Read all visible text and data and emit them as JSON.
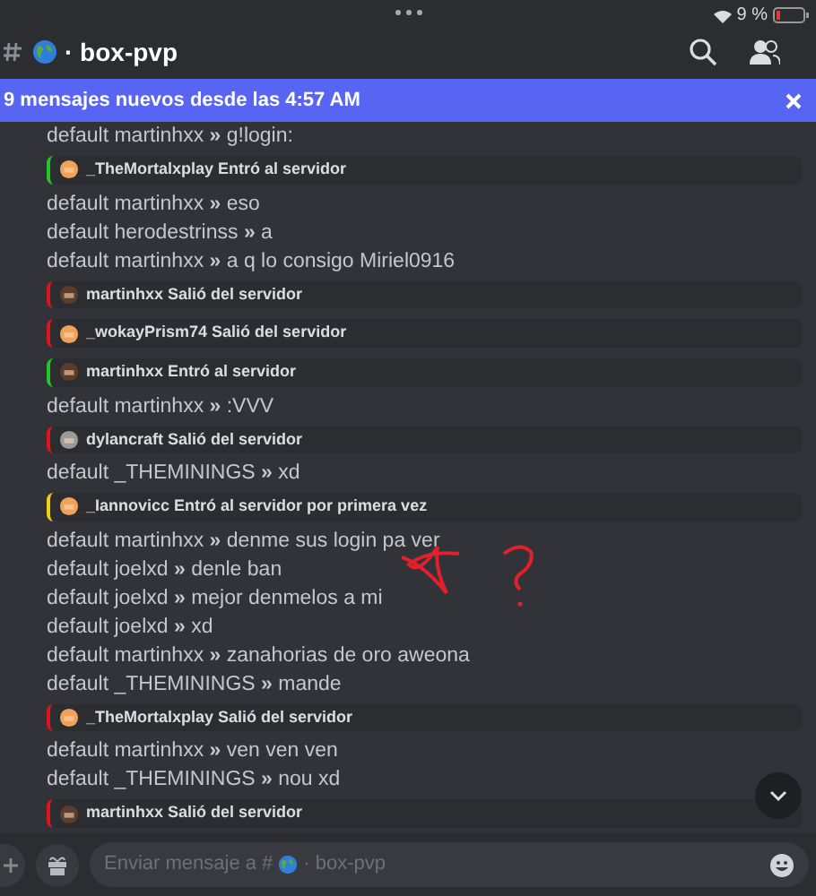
{
  "status_bar": {
    "battery_text": "9 %"
  },
  "header": {
    "channel": "· box-pvp"
  },
  "banner": {
    "text": "9 mensajes nuevos desde las 4:57 AM"
  },
  "messages": [
    {
      "kind": "chat",
      "text": "default martinhxx **»** g!login:"
    },
    {
      "kind": "join",
      "color": "#f0a25a",
      "text": "_TheMortalxplay Entró al servidor"
    },
    {
      "kind": "chat",
      "text": "default martinhxx **»** eso"
    },
    {
      "kind": "chat",
      "text": "default herodestrinss **»** a"
    },
    {
      "kind": "chat",
      "text": "default martinhxx **»** a q lo consigo Miriel0916"
    },
    {
      "kind": "leave",
      "color": "#5c3d2a",
      "text": "martinhxx Salió del servidor"
    },
    {
      "kind": "leave",
      "color": "#f0a25a",
      "text": "_wokayPrism74 Salió del servidor"
    },
    {
      "kind": "join",
      "color": "#5c3d2a",
      "text": "martinhxx Entró al servidor"
    },
    {
      "kind": "chat",
      "text": "default martinhxx **»** :VVV"
    },
    {
      "kind": "leave",
      "color": "#9a9a9a",
      "text": "dylancraft Salió del servidor"
    },
    {
      "kind": "chat",
      "text": "default _THEMININGS **»** xd"
    },
    {
      "kind": "first",
      "color": "#f0a25a",
      "text": "_Iannovicc Entró al servidor por primera vez"
    },
    {
      "kind": "chat",
      "text": "default martinhxx **»** denme sus login pa ver"
    },
    {
      "kind": "chat",
      "text": "default joelxd **»** denle ban"
    },
    {
      "kind": "chat",
      "text": "default joelxd **»** mejor denmelos a mi"
    },
    {
      "kind": "chat",
      "text": "default joelxd **»** xd"
    },
    {
      "kind": "chat",
      "text": "default martinhxx **»** zanahorias de oro aweona"
    },
    {
      "kind": "chat",
      "text": "default _THEMININGS **»** mande"
    },
    {
      "kind": "leave",
      "color": "#f0a25a",
      "text": "_TheMortalxplay Salió del servidor"
    },
    {
      "kind": "chat",
      "text": "default martinhxx **»** ven ven ven"
    },
    {
      "kind": "chat",
      "text": "default _THEMININGS **»** nou xd"
    },
    {
      "kind": "leave",
      "color": "#5c3d2a",
      "text": "martinhxx Salió del servidor"
    }
  ],
  "composer": {
    "placeholder_start": "Enviar mensaje a #",
    "placeholder_end": "· box-pvp"
  }
}
